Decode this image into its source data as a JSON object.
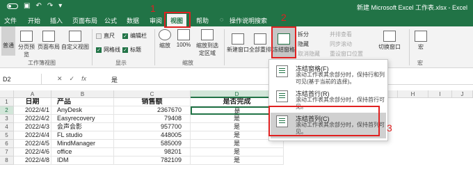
{
  "titlebar": {
    "title": "新建 Microsoft Excel 工作表.xlsx  -  Excel",
    "qat_icons": [
      "autosave-toggle",
      "save-icon",
      "undo-icon",
      "redo-icon"
    ]
  },
  "tabs": [
    "文件",
    "开始",
    "插入",
    "页面布局",
    "公式",
    "数据",
    "审阅",
    "视图",
    "帮助",
    "操作说明搜索"
  ],
  "active_tab": "视图",
  "annotations": [
    "1",
    "2",
    "3"
  ],
  "ribbon": {
    "views": {
      "normal": "普通",
      "page_break": "分页预览",
      "page_layout": "页面布局",
      "custom": "自定义视图",
      "group": "工作簿视图"
    },
    "show": {
      "ruler": "直尺",
      "formula_bar": "编辑栏",
      "gridlines": "网格线",
      "headings": "标题",
      "group": "显示"
    },
    "zoom": {
      "zoom": "缩放",
      "hundred": "100%",
      "to_selection": "缩放到选定区域",
      "group": "缩放"
    },
    "window": {
      "new_window": "新建窗口",
      "arrange_all": "全部重排",
      "freeze_panes": "冻结窗格",
      "split": "拆分",
      "hide": "隐藏",
      "unhide": "取消隐藏",
      "view_side": "并排查看",
      "sync_scroll": "同步滚动",
      "reset_position": "重设窗口位置",
      "switch_windows": "切换窗口"
    },
    "macros": {
      "label": "宏",
      "group": "宏"
    }
  },
  "formula_bar": {
    "name_box": "D2",
    "cancel": "✕",
    "enter": "✓",
    "fx": "fx",
    "value": "是"
  },
  "columns": [
    "A",
    "B",
    "C",
    "D",
    "E",
    "F",
    "G",
    "H",
    "I",
    "J"
  ],
  "rows": [
    {
      "num": "1",
      "A": "日期",
      "B": "产品",
      "C": "销售额",
      "D": "是否完成"
    },
    {
      "num": "2",
      "A": "2022/4/1",
      "B": "AnyDesk",
      "C": "2367670",
      "D": "是"
    },
    {
      "num": "3",
      "A": "2022/4/2",
      "B": "Easyrecovery",
      "C": "79408",
      "D": "是"
    },
    {
      "num": "4",
      "A": "2022/4/3",
      "B": "会声会影",
      "C": "957700",
      "D": "是"
    },
    {
      "num": "5",
      "A": "2022/4/4",
      "B": "FL studio",
      "C": "448005",
      "D": "是"
    },
    {
      "num": "6",
      "A": "2022/4/5",
      "B": "MindManager",
      "C": "585009",
      "D": "是"
    },
    {
      "num": "7",
      "A": "2022/4/6",
      "B": "office",
      "C": "98201",
      "D": "是"
    },
    {
      "num": "8",
      "A": "2022/4/8",
      "B": "IDM",
      "C": "782109",
      "D": "是"
    }
  ],
  "freeze_menu": [
    {
      "title": "冻结窗格(F)",
      "desc": "滚动工作表其余部分时，保持行和列可见(基于当前的选择)。"
    },
    {
      "title": "冻结首行(R)",
      "desc": "滚动工作表其余部分时，保持首行可见。"
    },
    {
      "title": "冻结首列(C)",
      "desc": "滚动工作表其余部分时，保持首列可见。"
    }
  ],
  "colors": {
    "excel_green": "#217346",
    "annotation_red": "#e02020",
    "highlight": "#d0d0d0"
  }
}
